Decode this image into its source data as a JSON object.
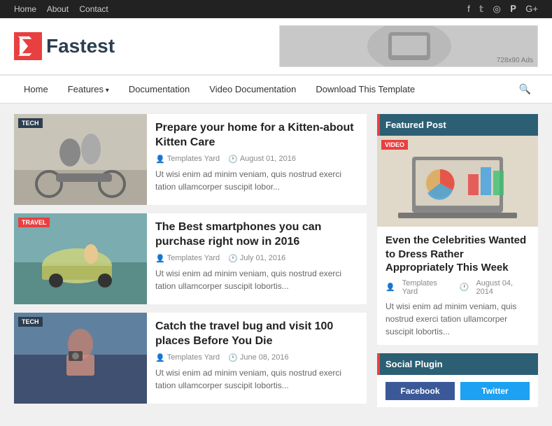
{
  "topbar": {
    "nav_items": [
      "Home",
      "About",
      "Contact"
    ],
    "social_icons": [
      "facebook",
      "twitter",
      "instagram",
      "pinterest",
      "google-plus"
    ]
  },
  "header": {
    "logo_text": "Fastest",
    "banner_ad_text": "728x90 Ads"
  },
  "nav": {
    "links": [
      {
        "label": "Home",
        "has_dropdown": false
      },
      {
        "label": "Features",
        "has_dropdown": true
      },
      {
        "label": "Documentation",
        "has_dropdown": false
      },
      {
        "label": "Video Documentation",
        "has_dropdown": false
      },
      {
        "label": "Download This Template",
        "has_dropdown": false
      }
    ],
    "search_icon": "search"
  },
  "articles": [
    {
      "badge": "TECH",
      "badge_type": "dark",
      "title": "Prepare your home for a Kitten-about Kitten Care",
      "author": "Templates Yard",
      "date": "August 01, 2016",
      "excerpt": "Ut wisi enim ad minim veniam, quis nostrud exerci tation ullamcorper suscipit lobor..."
    },
    {
      "badge": "TRAVEL",
      "badge_type": "red",
      "title": "The Best smartphones you can purchase right now in 2016",
      "author": "Templates Yard",
      "date": "July 01, 2016",
      "excerpt": "Ut wisi enim ad minim veniam, quis nostrud exerci tation ullamcorper suscipit lobortis..."
    },
    {
      "badge": "TECH",
      "badge_type": "dark",
      "title": "Catch the travel bug and visit 100 places Before You Die",
      "author": "Templates Yard",
      "date": "June 08, 2016",
      "excerpt": "Ut wisi enim ad minim veniam, quis nostrud exerci tation ullamcorper suscipit lobortis..."
    }
  ],
  "sidebar": {
    "featured_widget_title": "Featured Post",
    "featured_post": {
      "video_badge": "VIDEO",
      "title": "Even the Celebrities Wanted to Dress Rather Appropriately This Week",
      "author": "Templates Yard",
      "date": "August 04, 2014",
      "excerpt": "Ut wisi enim ad minim veniam, quis nostrud exerci tation ullamcorper suscipit lobortis..."
    },
    "social_widget_title": "Social Plugin",
    "social_buttons": [
      {
        "label": "Facebook",
        "platform": "facebook"
      },
      {
        "label": "Twitter",
        "platform": "twitter"
      }
    ]
  }
}
